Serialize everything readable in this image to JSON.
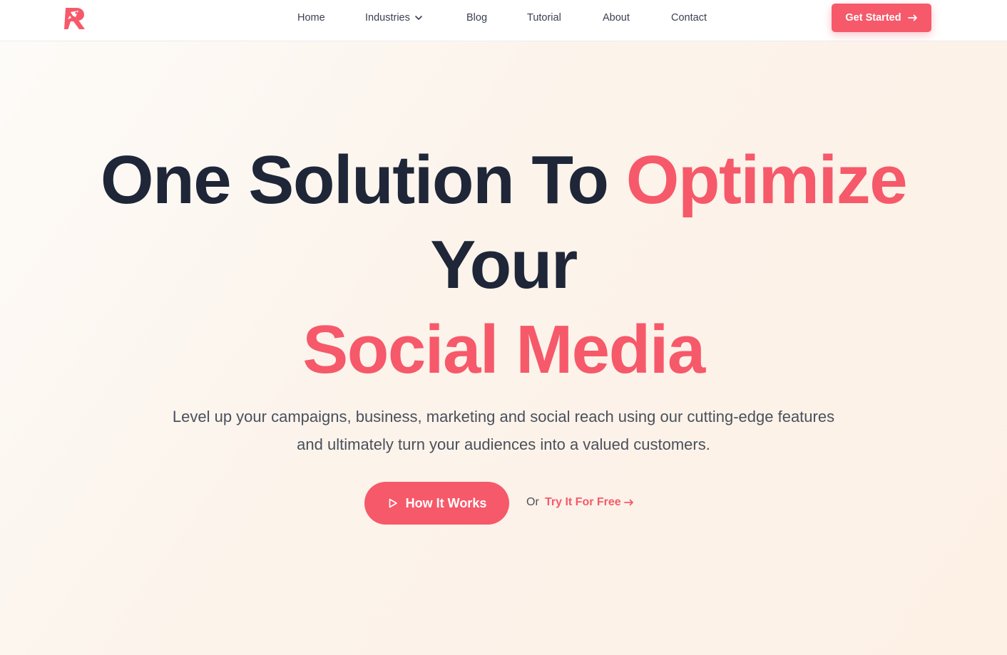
{
  "nav": {
    "logo_icon": "r-rocket-logo-icon",
    "links": [
      "Home",
      "Industries",
      "Blog",
      "Tutorial",
      "About",
      "Contact"
    ],
    "industries_icon": "chevron-down-icon",
    "cta_label": "Get Started",
    "cta_icon": "arrow-right-icon"
  },
  "hero": {
    "headline": {
      "part1": "One Solution To ",
      "part2": "Optimize",
      "line2": "Your",
      "line3": "Social Media"
    },
    "subtitle": "Level up your campaigns, business, marketing and social reach using our cutting-edge features and ultimately turn your audiences into a valued customers.",
    "primary_button": {
      "label": "How It Works",
      "icon": "play-icon"
    },
    "or_text": "Or",
    "secondary_link": {
      "label": "Try It For Free",
      "icon": "arrow-right-icon"
    }
  },
  "colors": {
    "accent": "#f6596a",
    "heading": "#1e2638",
    "body_text": "#4a505c",
    "background": "#fdf6ef"
  }
}
